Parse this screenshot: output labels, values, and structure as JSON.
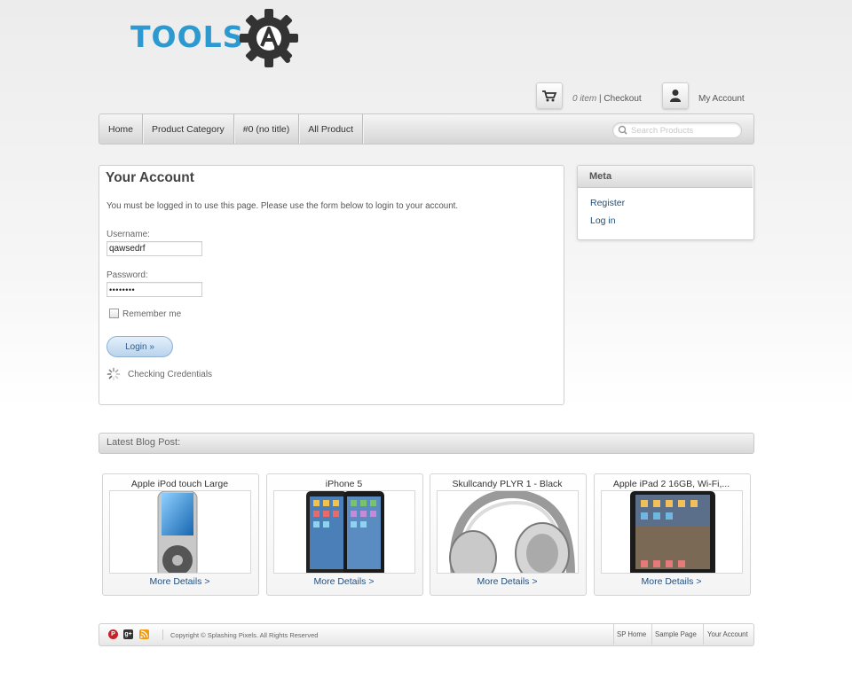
{
  "logo": {
    "text": "TOOLS",
    "accent_color": "#2c9ad1"
  },
  "header": {
    "cart_count": "0 item",
    "cart_separator": "|",
    "checkout_label": "Checkout",
    "account_label": "My Account"
  },
  "nav": {
    "items": [
      {
        "label": "Home"
      },
      {
        "label": "Product Category"
      },
      {
        "label": "#0 (no title)"
      },
      {
        "label": "All Product"
      }
    ],
    "search_placeholder": "Search Products"
  },
  "account": {
    "title": "Your Account",
    "message": "You must be logged in to use this page. Please use the form below to login to your account.",
    "username_label": "Username:",
    "username_value": "qawsedrf",
    "password_label": "Password:",
    "password_value": "••••••••",
    "remember_label": "Remember me",
    "login_button": "Login »",
    "status_text": "Checking Credentials"
  },
  "meta": {
    "title": "Meta",
    "links": [
      {
        "label": "Register"
      },
      {
        "label": "Log in"
      }
    ]
  },
  "blog": {
    "title": "Latest Blog Post:",
    "products": [
      {
        "name": "Apple iPod touch Large",
        "more": "More Details >"
      },
      {
        "name": "iPhone 5",
        "more": "More Details >"
      },
      {
        "name": "Skullcandy PLYR 1 - Black",
        "more": "More Details >"
      },
      {
        "name": "Apple iPad 2 16GB, Wi-Fi,...",
        "more": "More Details >"
      }
    ]
  },
  "footer": {
    "copyright": "Copyright © Splashing Pixels. All Rights Reserved",
    "links": [
      {
        "label": "SP Home"
      },
      {
        "label": "Sample Page"
      },
      {
        "label": "Your Account"
      }
    ]
  }
}
